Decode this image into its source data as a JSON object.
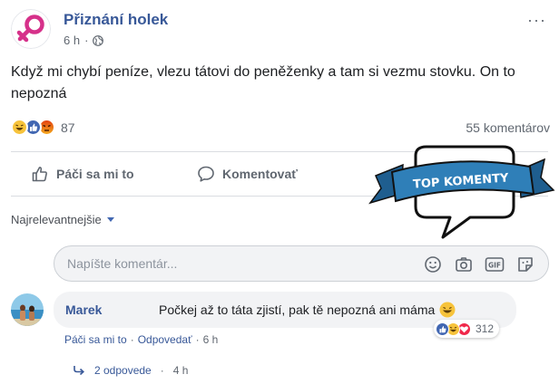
{
  "post": {
    "page_name": "Přiznání holek",
    "time": "6 h",
    "more_label": "···",
    "text": "Když mi chybí peníze, vlezu tátovi do peněženky a tam si vezmu stovku. On to nepozná",
    "reactions": {
      "icons": [
        "haha-icon",
        "like-icon",
        "angry-icon"
      ],
      "count": "87"
    },
    "comments_count": "55 komentárov"
  },
  "actions": {
    "like_label": "Páči sa mi to",
    "comment_label": "Komentovať"
  },
  "banner": {
    "label": "TOP KOMENTY"
  },
  "comments_section": {
    "sort_label": "Najrelevantnejšie",
    "composer_placeholder": "Napíšte komentár...",
    "composer_icons": [
      "emoji-icon",
      "camera-icon",
      "gif-icon",
      "sticker-icon"
    ]
  },
  "comment": {
    "author": "Marek",
    "text": "Počkej až to táta zjistí, pak tě nepozná ani máma",
    "reactions": {
      "icons": [
        "like-icon",
        "haha-icon",
        "love-icon"
      ],
      "count": "312"
    },
    "like_label": "Páči sa mi to",
    "separator": "·",
    "reply_label": "Odpovedať",
    "time": "6 h",
    "replies_label": "2 odpovede",
    "replies_time": "4 h"
  },
  "colors": {
    "brand_blue": "#385898",
    "like_blue": "#4267b2",
    "page_logo": "#d6318a",
    "haha_yellow": "#f7c33b",
    "angry_orange": "#e9710f",
    "love_red": "#f0284a",
    "banner_blue": "#2f7fb8"
  }
}
